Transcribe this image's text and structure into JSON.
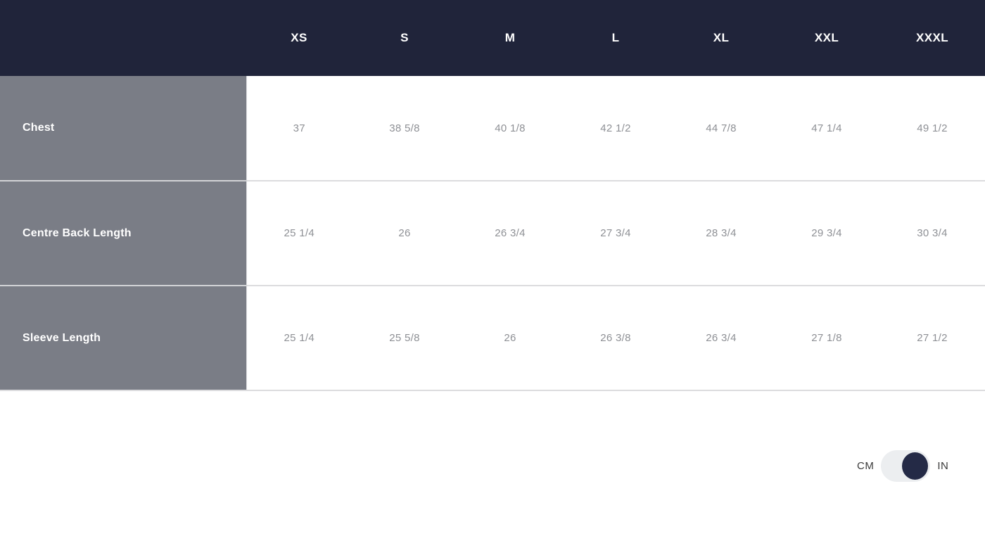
{
  "table": {
    "corner_label": "",
    "size_headers": [
      "XS",
      "S",
      "M",
      "L",
      "XL",
      "XXL",
      "XXXL"
    ],
    "rows": [
      {
        "label": "Chest",
        "values": [
          "37",
          "38 5/8",
          "40 1/8",
          "42 1/2",
          "44 7/8",
          "47 1/4",
          "49 1/2"
        ]
      },
      {
        "label": "Centre Back Length",
        "values": [
          "25 1/4",
          "26",
          "26 3/4",
          "27 3/4",
          "28 3/4",
          "29 3/4",
          "30 3/4"
        ]
      },
      {
        "label": "Sleeve Length",
        "values": [
          "25 1/4",
          "25 5/8",
          "26",
          "26 3/8",
          "26 3/4",
          "27 1/8",
          "27 1/2"
        ]
      }
    ]
  },
  "unit_toggle": {
    "left_label": "CM",
    "right_label": "IN",
    "selected": "IN"
  },
  "colors": {
    "header_background": "#20243a",
    "row_label_background": "#7a7d86",
    "value_text": "#8e9095",
    "toggle_track": "#eceef0",
    "toggle_knob": "#242a46",
    "row_divider": "#dcdcde"
  }
}
